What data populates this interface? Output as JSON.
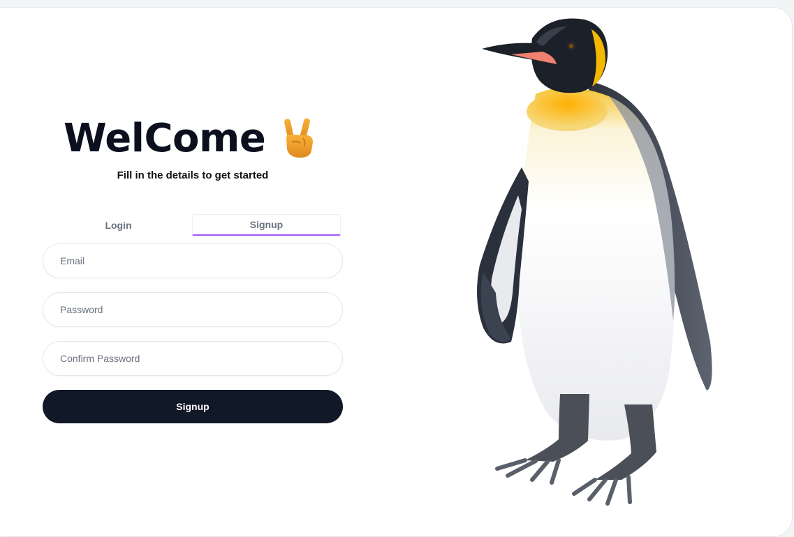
{
  "welcome": {
    "title": "WelCome",
    "subtitle": "Fill in the details to get started"
  },
  "tabs": [
    {
      "label": "Login",
      "active": false
    },
    {
      "label": "Signup",
      "active": true
    }
  ],
  "form": {
    "email_placeholder": "Email",
    "password_placeholder": "Password",
    "confirm_password_placeholder": "Confirm Password",
    "submit_label": "Signup"
  },
  "theme": {
    "accent": "#a855f7",
    "button": "#111827",
    "text_dark": "#0b0f1e"
  },
  "illustration": {
    "icon": "penguin-illustration",
    "emoji": "peace-hand-icon"
  }
}
